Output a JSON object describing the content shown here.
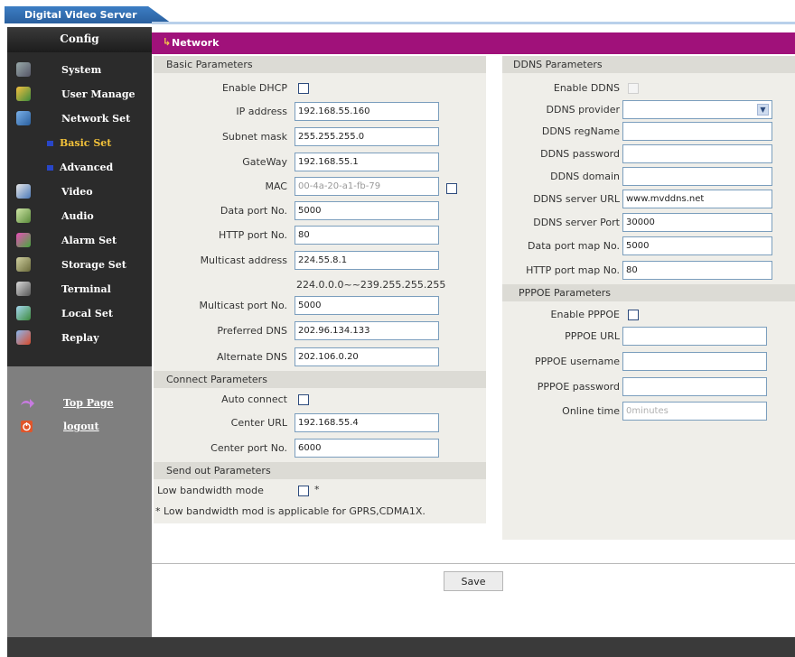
{
  "app": {
    "brand": "Digital Video Server"
  },
  "sidebar": {
    "header": "Config",
    "items": [
      {
        "label": "System",
        "icon": "system-icon",
        "sub": false
      },
      {
        "label": "User Manage",
        "icon": "users-icon",
        "sub": false
      },
      {
        "label": "Network Set",
        "icon": "network-icon",
        "sub": false
      },
      {
        "label": "Basic Set",
        "icon": "",
        "sub": true,
        "active": true
      },
      {
        "label": "Advanced",
        "icon": "",
        "sub": true
      },
      {
        "label": "Video",
        "icon": "video-icon",
        "sub": false
      },
      {
        "label": "Audio",
        "icon": "audio-icon",
        "sub": false
      },
      {
        "label": "Alarm Set",
        "icon": "alarm-icon",
        "sub": false
      },
      {
        "label": "Storage Set",
        "icon": "storage-icon",
        "sub": false
      },
      {
        "label": "Terminal",
        "icon": "terminal-icon",
        "sub": false
      },
      {
        "label": "Local Set",
        "icon": "local-icon",
        "sub": false
      },
      {
        "label": "Replay",
        "icon": "replay-icon",
        "sub": false
      }
    ],
    "links": [
      {
        "label": "Top Page",
        "icon": "arrow-icon"
      },
      {
        "label": "logout",
        "icon": "power-icon"
      }
    ]
  },
  "content": {
    "section_arrow": "↳",
    "title": "Network"
  },
  "basic": {
    "title": "Basic Parameters",
    "enable_dhcp": "Enable DHCP",
    "ip_label": "IP address",
    "ip": "192.168.55.160",
    "mask_label": "Subnet mask",
    "mask": "255.255.255.0",
    "gateway_label": "GateWay",
    "gateway": "192.168.55.1",
    "mac_label": "MAC",
    "mac": "00-4a-20-a1-fb-79",
    "data_port_label": "Data port No.",
    "data_port": "5000",
    "http_port_label": "HTTP port No.",
    "http_port": "80",
    "multicast_label": "Multicast address",
    "multicast": "224.55.8.1",
    "multicast_range": "224.0.0.0~~239.255.255.255",
    "multicast_port_label": "Multicast port No.",
    "multicast_port": "5000",
    "pref_dns_label": "Preferred DNS",
    "pref_dns": "202.96.134.133",
    "alt_dns_label": "Alternate DNS",
    "alt_dns": "202.106.0.20"
  },
  "connect": {
    "title": "Connect Parameters",
    "auto_label": "Auto connect",
    "center_url_label": "Center URL",
    "center_url": "192.168.55.4",
    "center_port_label": "Center port No.",
    "center_port": "6000"
  },
  "sendout": {
    "title": "Send out Parameters",
    "low_bw_label": "Low bandwidth mode",
    "low_bw_star": "*",
    "note": "* Low bandwidth mod is applicable for GPRS,CDMA1X."
  },
  "ddns": {
    "title": "DDNS Parameters",
    "enable_label": "Enable DDNS",
    "provider_label": "DDNS provider",
    "provider": "",
    "regname_label": "DDNS regName",
    "regname": "",
    "password_label": "DDNS password",
    "password": "",
    "domain_label": "DDNS domain",
    "domain": "",
    "server_url_label": "DDNS server URL",
    "server_url": "www.mvddns.net",
    "server_port_label": "DDNS server Port",
    "server_port": "30000",
    "data_map_label": "Data port map No.",
    "data_map": "5000",
    "http_map_label": "HTTP port map No.",
    "http_map": "80"
  },
  "pppoe": {
    "title": "PPPOE Parameters",
    "enable_label": "Enable PPPOE",
    "url_label": "PPPOE URL",
    "url": "",
    "username_label": "PPPOE username",
    "username": "",
    "password_label": "PPPOE password",
    "password": "",
    "online_label": "Online time",
    "online": "0minutes"
  },
  "actions": {
    "save": "Save"
  },
  "colors": {
    "header": "#a0117a",
    "sidebar": "#2b2b2b",
    "panel": "#efeee9",
    "active": "#f3c23a"
  }
}
